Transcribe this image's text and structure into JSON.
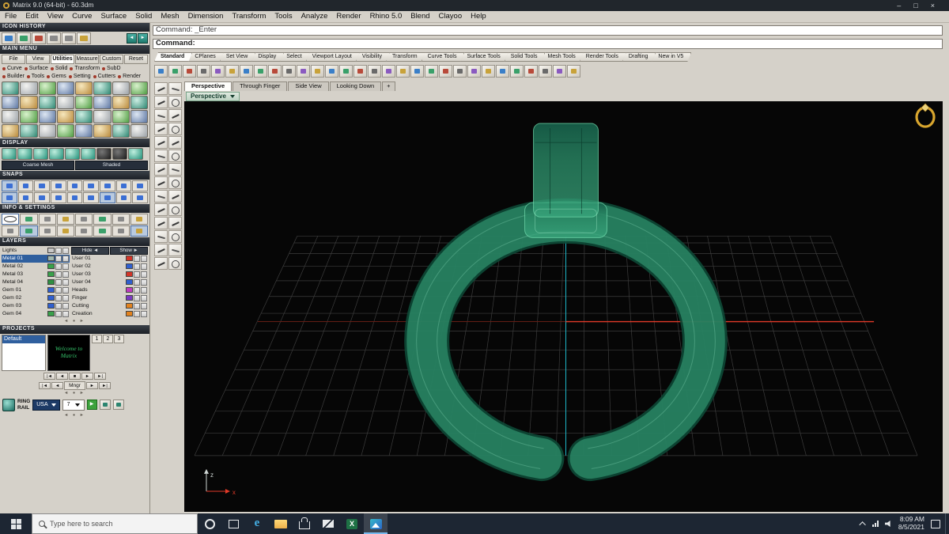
{
  "colors": {
    "ui_gray": "#d5d1c9",
    "select_blue": "#2f5f9e",
    "ring_green": "#2fa57c",
    "grid_line": "#3c3c3c",
    "axis_red": "#e23a28",
    "axis_cyan": "#1fb7c9",
    "taskbar_bg": "#1d2633",
    "gold": "#d1a136"
  },
  "window": {
    "title": "Matrix 9.0 (64-bit) - 60.3dm",
    "controls": {
      "minimize": "–",
      "maximize": "□",
      "close": "×"
    }
  },
  "menu": [
    "File",
    "Edit",
    "View",
    "Curve",
    "Surface",
    "Solid",
    "Mesh",
    "Dimension",
    "Transform",
    "Tools",
    "Analyze",
    "Render",
    "Rhino 5.0",
    "Blend",
    "Clayoo",
    "Help"
  ],
  "command": {
    "history": "Command: _Enter",
    "prompt": "Command:"
  },
  "toolbar_tabs": [
    {
      "label": "Standard",
      "active": true
    },
    {
      "label": "CPlanes"
    },
    {
      "label": "Set View"
    },
    {
      "label": "Display"
    },
    {
      "label": "Select"
    },
    {
      "label": "Viewport Layout"
    },
    {
      "label": "Visibility"
    },
    {
      "label": "Transform"
    },
    {
      "label": "Curve Tools"
    },
    {
      "label": "Surface Tools"
    },
    {
      "label": "Solid Tools"
    },
    {
      "label": "Mesh Tools"
    },
    {
      "label": "Render Tools"
    },
    {
      "label": "Drafting"
    },
    {
      "label": "New in V5"
    }
  ],
  "toolbar_icons": [
    "new-file",
    "open-file",
    "save",
    "print",
    "cut",
    "copy",
    "paste",
    "undo",
    "redo",
    "delete",
    "pan-view",
    "zoom-dynamic",
    "zoom-window",
    "zoom-extents",
    "zoom-selected",
    "rotate-view",
    "four-viewports",
    "undo-view",
    "object-snap",
    "gumball",
    "record-history",
    "selection-filter",
    "move",
    "rotate",
    "scale",
    "mirror",
    "join",
    "trim",
    "split",
    "object-properties"
  ],
  "toolstrip_icons": [
    "select",
    "selection-window",
    "move",
    "copy-object",
    "rotate-tool",
    "scale-tool",
    "single-point",
    "line",
    "polyline",
    "rectangle",
    "circle",
    "arc",
    "ellipse",
    "polygon",
    "control-point-curve",
    "interpolate-curve",
    "fillet-curves",
    "offset-curve",
    "trim-tool",
    "split-tool",
    "extend-curve",
    "join-tool",
    "extrude-surface",
    "revolve-surface",
    "sweep-surface",
    "loft-surface",
    "boolean-union",
    "analyze-object"
  ],
  "viewport": {
    "tabs": [
      {
        "label": "Perspective",
        "active": true
      },
      {
        "label": "Through Finger"
      },
      {
        "label": "Side View"
      },
      {
        "label": "Looking Down"
      }
    ],
    "add_tab": "+",
    "selector": "Perspective",
    "axis_x": "x",
    "axis_z": "z"
  },
  "sidebar": {
    "icon_history": {
      "title": "ICON HISTORY",
      "count": 6,
      "back": "◄",
      "fwd": "►"
    },
    "main_menu": {
      "title": "MAIN MENU",
      "tabs": [
        {
          "label": "File"
        },
        {
          "label": "View"
        },
        {
          "label": "Utilities",
          "active": true
        },
        {
          "label": "Measure"
        },
        {
          "label": "Custom"
        },
        {
          "label": "Reset"
        }
      ],
      "row1": [
        "Curve",
        "Surface",
        "Solid",
        "Transform",
        "SubD"
      ],
      "row2": [
        "Builder",
        "Tools",
        "Gems",
        "Setting",
        "Cutters",
        "Render"
      ],
      "tool_count": 32
    },
    "display": {
      "title": "DISPLAY",
      "count": 9,
      "modes": [
        "Coarse Mesh",
        "Shaded"
      ]
    },
    "snaps": {
      "title": "SNAPS",
      "count": 18
    },
    "info": {
      "title": "INFO & SETTINGS",
      "count": 16
    },
    "layers": {
      "title": "LAYERS",
      "hide": "Hide ◄",
      "show": "Show ►",
      "left": [
        {
          "name": "Lights",
          "color": "#c8c8c8"
        },
        {
          "name": "Metal 01",
          "color": "#9fb6ae",
          "selected": true
        },
        {
          "name": "Metal 02",
          "color": "#39a04a"
        },
        {
          "name": "Metal 03",
          "color": "#39a04a"
        },
        {
          "name": "Metal 04",
          "color": "#2f8f42"
        },
        {
          "name": "Gem 01",
          "color": "#2f5fd0"
        },
        {
          "name": "Gem 02",
          "color": "#2f5fd0"
        },
        {
          "name": "Gem 03",
          "color": "#2f5fd0"
        },
        {
          "name": "Gem 04",
          "color": "#39a04a"
        }
      ],
      "right": [
        {
          "name": "User 01",
          "color": "#d23528"
        },
        {
          "name": "User 02",
          "color": "#2f5fd0"
        },
        {
          "name": "User 03",
          "color": "#d23528"
        },
        {
          "name": "User 04",
          "color": "#2f5fd0"
        },
        {
          "name": "Heads",
          "color": "#c13ac1"
        },
        {
          "name": "Finger",
          "color": "#7a3ac1"
        },
        {
          "name": "Cutting",
          "color": "#e2821e"
        },
        {
          "name": "Creation",
          "color": "#e2821e"
        }
      ]
    },
    "projects": {
      "title": "PROJECTS",
      "list": [
        {
          "name": "Default",
          "selected": true
        }
      ],
      "thumb": [
        "Welcome to",
        "Matrix"
      ],
      "tabs": [
        "1",
        "2",
        "3"
      ],
      "pager": [
        "|◄",
        "◄",
        "■",
        "►",
        "►|"
      ],
      "mngr": "Mngr"
    },
    "ring_rail": {
      "line1": "RING",
      "line2": "RAIL",
      "region": "USA",
      "size": "7",
      "go": "▶"
    }
  },
  "taskbar": {
    "search_placeholder": "Type here to search",
    "apps": [
      {
        "name": "edge"
      },
      {
        "name": "file-explorer"
      },
      {
        "name": "store"
      },
      {
        "name": "mail"
      },
      {
        "name": "excel"
      },
      {
        "name": "photos",
        "active": true
      }
    ],
    "time": "8:09 AM",
    "date": "8/5/2021"
  }
}
